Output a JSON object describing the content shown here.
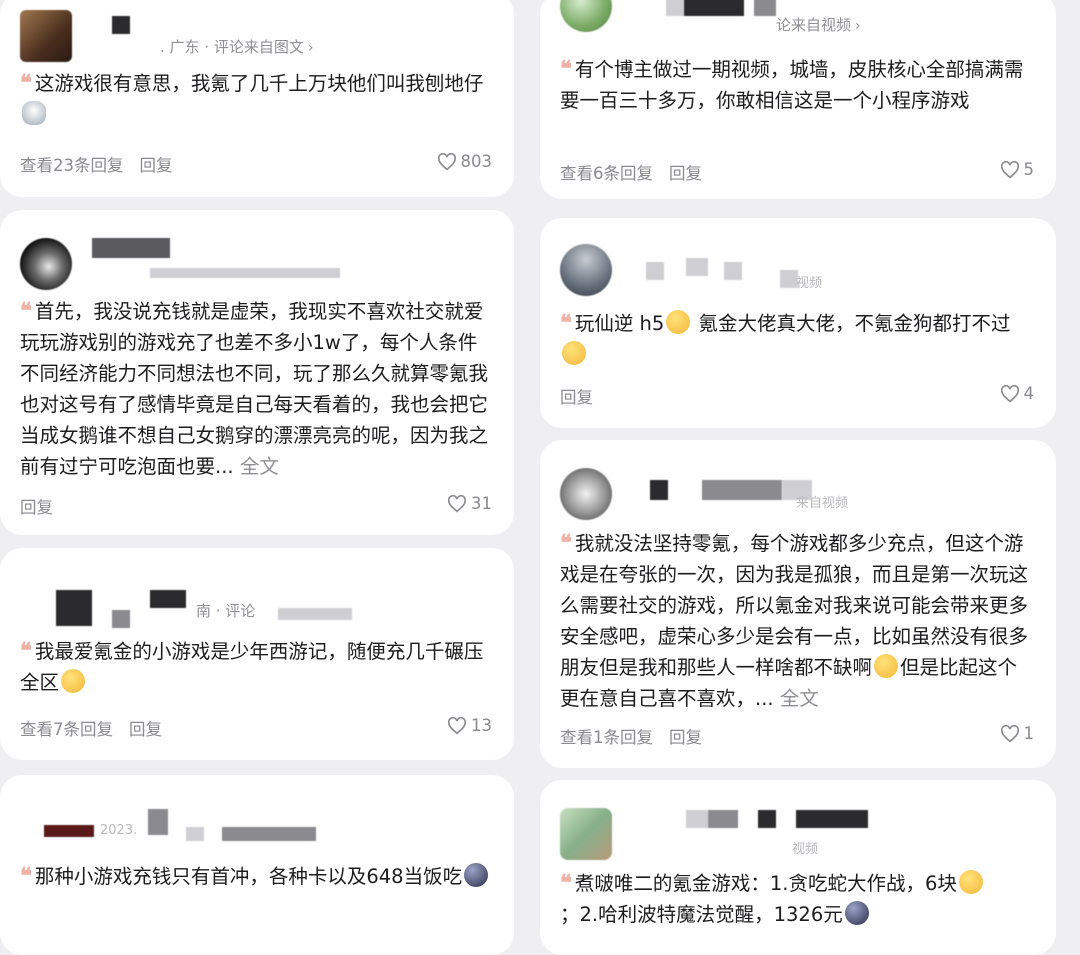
{
  "comments": [
    {
      "meta": ". 广东 · 评论来自图文",
      "chevron": "›",
      "text": "这游戏很有意思，我氪了几千上万块他们叫我刨地仔",
      "emoji": "cat-emoji",
      "replies": "查看23条回复",
      "reply_label": "回复",
      "likes": "803"
    },
    {
      "meta": "",
      "text": "首先，我没说充钱就是虚荣，我现实不喜欢社交就爱玩玩游戏别的游戏充了也差不多小1w了，每个人条件不同经济能力不同想法也不同，玩了那么久就算零氪我也对这号有了感情毕竟是自己每天看着的，我也会把它当成女鹅谁不想自己女鹅穿的漂漂亮亮的呢，因为我之前有过宁可吃泡面也要...",
      "more": "全文",
      "reply_label": "回复",
      "likes": "31"
    },
    {
      "meta": "南 · 评论",
      "text": "我最爱氪金的小游戏是少年西游记，随便充几千碾压全区",
      "emoji": "laugh-cry-emoji",
      "replies": "查看7条回复",
      "reply_label": "回复",
      "likes": "13"
    },
    {
      "meta": "2023.",
      "text": "那种小游戏充钱只有首冲，各种卡以及648当饭吃",
      "emoji": "dark-face-emoji"
    },
    {
      "meta": "论来自视频",
      "chevron": "›",
      "text": "有个博主做过一期视频，城墙，皮肤核心全部搞满需要一百三十多万，你敢相信这是一个小程序游戏",
      "replies": "查看6条回复",
      "reply_label": "回复",
      "likes": "5"
    },
    {
      "meta": "视频",
      "text_a": "玩仙逆 h5",
      "text_b": "氪金大佬真大佬，不氪金狗都打不过",
      "emoji": "cry-emoji",
      "reply_label": "回复",
      "likes": "4"
    },
    {
      "meta": "来自视频",
      "text_a": "我就没法坚持零氪，每个游戏都多少充点，但这个游戏是在夸张的一次，因为我是孤狼，而且是第一次玩这么需要社交的游戏，所以氪金对我来说可能会带来更多安全感吧，虚荣心多少是会有一点，比如虽然没有很多朋友但是我和那些人一样啥都不缺啊",
      "text_b": "但是比起这个更在意自己喜不喜欢，...",
      "more": "全文",
      "emoji": "worried-emoji",
      "replies": "查看1条回复",
      "reply_label": "回复",
      "likes": "1"
    },
    {
      "meta": "视频",
      "text_a": "煮啵唯二的氪金游戏：1.贪吃蛇大作战，6块",
      "text_b": "；2.哈利波特魔法觉醒，1326元",
      "emoji_a": "smirk-emoji",
      "emoji_b": "dark-face-emoji"
    }
  ]
}
